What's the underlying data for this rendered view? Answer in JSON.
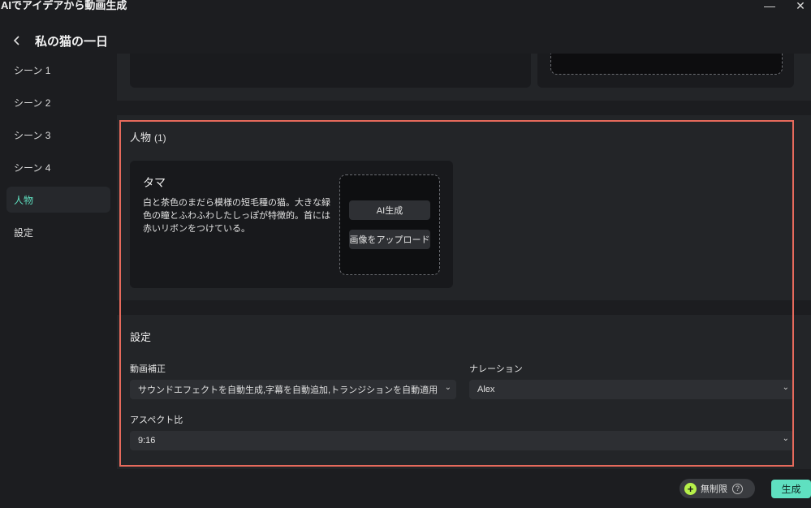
{
  "window": {
    "title": "AIでアイデアから動画生成",
    "minimize_icon": "minimize-icon",
    "close_icon": "close-icon"
  },
  "header": {
    "back_icon": "chevron-left-icon",
    "title": "私の猫の一日"
  },
  "sidebar": {
    "items": [
      {
        "label": "シーン 1",
        "active": false
      },
      {
        "label": "シーン 2",
        "active": false
      },
      {
        "label": "シーン 3",
        "active": false
      },
      {
        "label": "シーン 4",
        "active": false
      },
      {
        "label": "人物",
        "active": true
      },
      {
        "label": "設定",
        "active": false
      }
    ]
  },
  "persons": {
    "title": "人物",
    "count": "(1)",
    "characters": [
      {
        "name": "タマ",
        "description": "白と茶色のまだら模様の短毛種の猫。大きな緑色の瞳とふわふわしたしっぽが特徴的。首には赤いリボンをつけている。",
        "ai_generate_label": "AI生成",
        "upload_label": "画像をアップロード"
      }
    ]
  },
  "settings": {
    "title": "設定",
    "video_correction": {
      "label": "動画補正",
      "value": "サウンドエフェクトを自動生成,字幕を自動追加,トランジションを自動適用"
    },
    "narration": {
      "label": "ナレーション",
      "value": "Alex"
    },
    "aspect_ratio": {
      "label": "アスペクト比",
      "value": "9:16"
    }
  },
  "footer": {
    "unlimited_label": "無制限",
    "plus_icon": "plus-circle-icon",
    "help_icon": "help-circle-icon",
    "generate_label": "生成"
  },
  "colors": {
    "accent": "#5fe0c0",
    "highlight_border": "#e66a5c",
    "unlimited_icon": "#b6f04a"
  }
}
